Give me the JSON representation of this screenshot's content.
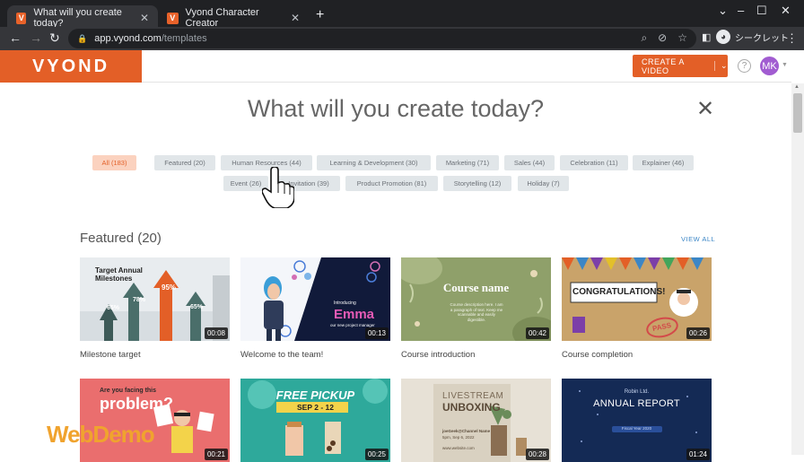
{
  "browser": {
    "tabs": [
      {
        "title": "What will you create today?",
        "favicon": "V"
      },
      {
        "title": "Vyond Character Creator",
        "favicon": "V"
      }
    ],
    "url_host": "app.vyond.com",
    "url_path": "/templates",
    "profile_label": "シークレット"
  },
  "header": {
    "logo": "VYOND",
    "create_button": "CREATE A VIDEO",
    "help": "?",
    "user_initials": "MK"
  },
  "page": {
    "title": "What will you create today?",
    "filters_row1": [
      "All (183)",
      "Featured (20)",
      "Human Resources (44)",
      "Learning & Development (30)",
      "Marketing (71)",
      "Sales (44)",
      "Celebration (11)",
      "Explainer (46)"
    ],
    "filters_row2": [
      "Event (26)",
      "Invitation (39)",
      "Product Promotion (81)",
      "Storytelling (12)",
      "Holiday (7)"
    ],
    "section_title": "Featured (20)",
    "view_all": "VIEW ALL",
    "cards_row1": [
      {
        "label": "Milestone target",
        "duration": "00:08"
      },
      {
        "label": "Welcome to the team!",
        "duration": "00:13"
      },
      {
        "label": "Course introduction",
        "duration": "00:42"
      },
      {
        "label": "Course completion",
        "duration": "00:26"
      }
    ],
    "cards_row2": [
      {
        "label": "",
        "duration": "00:21"
      },
      {
        "label": "",
        "duration": "00:25"
      },
      {
        "label": "",
        "duration": "00:28"
      },
      {
        "label": "",
        "duration": "01:24"
      }
    ],
    "thumb_text": {
      "milestone_title": "Target Annual Milestones",
      "milestone_pcts": [
        "65%",
        "78%",
        "95%",
        "65%"
      ],
      "welcome_intro": "Introducing",
      "welcome_name": "Emma",
      "welcome_sub": "our new project manager",
      "course_name": "Course name",
      "course_desc": "Course description here. I am a paragraph of text. Keep me scannable and easily digestible.",
      "congrats": "CONGRATULATIONS!",
      "pass": "PASS",
      "problem_q": "Are you facing this",
      "problem_word": "problem?",
      "free_pickup": "FREE PICKUP",
      "pickup_dates": "SEP 2 - 12",
      "livestream": "LIVESTREAM",
      "unboxing": "UNBOXING",
      "channel": "joeGeek@Channel Name",
      "channel_date": "5pm, Sep 6, 2022",
      "website": "www.website.com",
      "robin": "Robin Ltd.",
      "annual_report": "ANNUAL REPORT",
      "fiscal_year": "Fiscal Year 2020"
    },
    "watermark": "WebDemo"
  },
  "colors": {
    "brand": "#e35f27",
    "chip": "#e1e6e9",
    "chip_selected": "#fbd2bf",
    "link": "#3b86c6"
  }
}
